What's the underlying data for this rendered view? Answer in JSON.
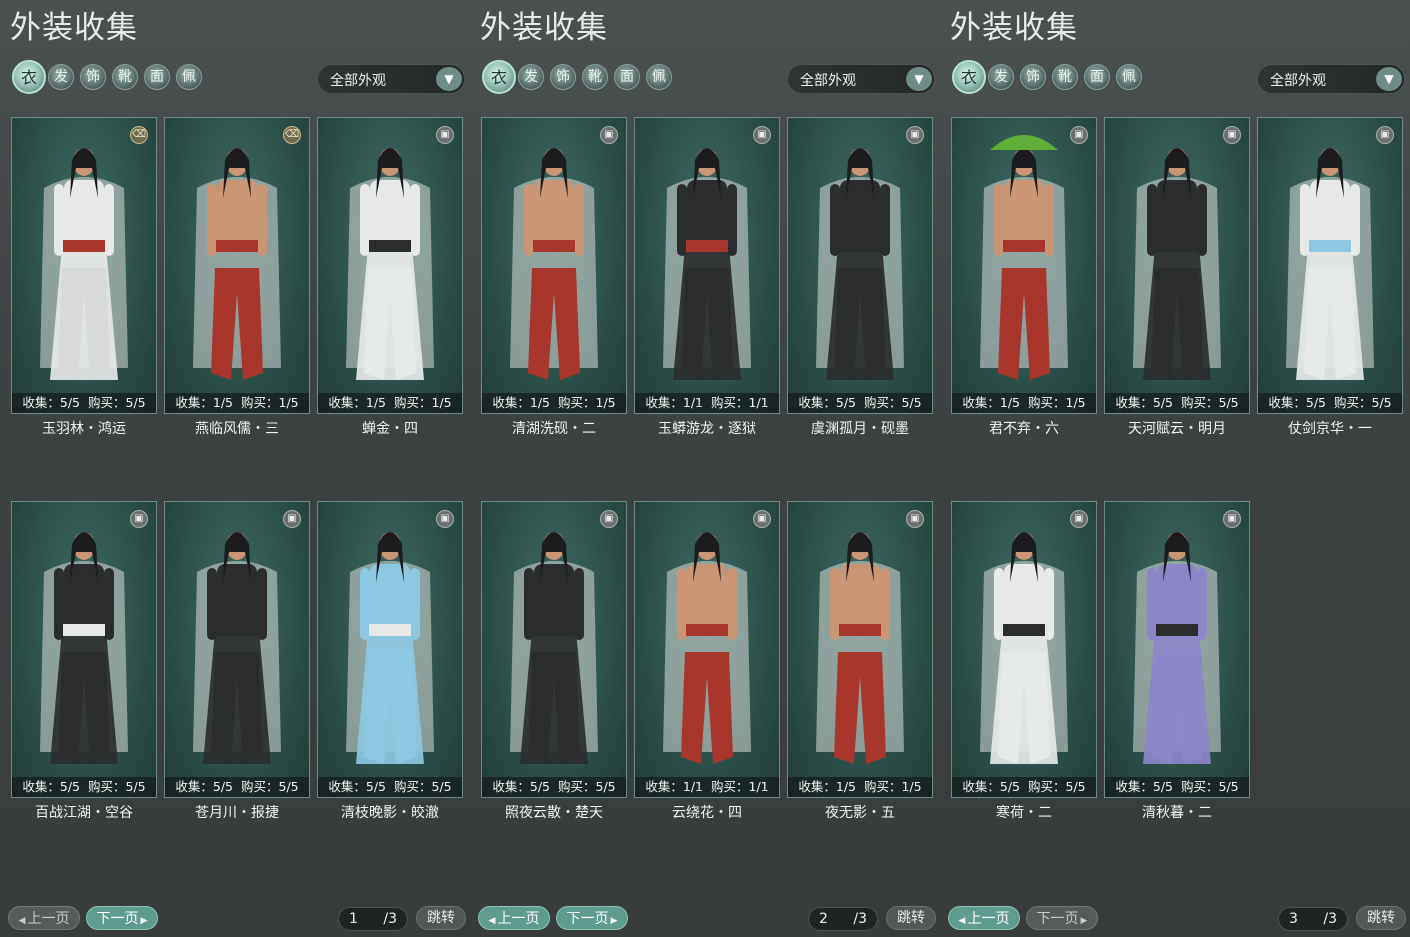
{
  "panels": [
    {
      "title": "外装收集",
      "filter_label": "全部外观",
      "pager": {
        "prev": "上一页",
        "next": "下一页",
        "current": "1",
        "total": "/3",
        "jump": "跳转"
      },
      "cards": [
        {
          "name": "玉羽林・鸿运",
          "collect": "收集：5/5",
          "buy": "购买：5/5",
          "icon": "trash-icon"
        },
        {
          "name": "燕临风儒・三",
          "collect": "收集：1/5",
          "buy": "购买：1/5",
          "icon": "trash-icon"
        },
        {
          "name": "蝉金・四",
          "collect": "收集：1/5",
          "buy": "购买：1/5",
          "icon": "wardrobe-icon"
        },
        {
          "name": "百战江湖・空谷",
          "collect": "收集：5/5",
          "buy": "购买：5/5",
          "icon": "wardrobe-icon"
        },
        {
          "name": "苍月川・报捷",
          "collect": "收集：5/5",
          "buy": "购买：5/5",
          "icon": "wardrobe-icon"
        },
        {
          "name": "清枝晚影・皎澈",
          "collect": "收集：5/5",
          "buy": "购买：5/5",
          "icon": "wardrobe-icon"
        }
      ]
    },
    {
      "title": "外装收集",
      "filter_label": "全部外观",
      "pager": {
        "prev": "上一页",
        "next": "下一页",
        "current": "2",
        "total": "/3",
        "jump": "跳转"
      },
      "cards": [
        {
          "name": "清湖洗砚・二",
          "collect": "收集：1/5",
          "buy": "购买：1/5",
          "icon": "wardrobe-icon"
        },
        {
          "name": "玉蟒游龙・逐狱",
          "collect": "收集：1/1",
          "buy": "购买：1/1",
          "icon": "wardrobe-icon"
        },
        {
          "name": "虞渊孤月・砚墨",
          "collect": "收集：5/5",
          "buy": "购买：5/5",
          "icon": "wardrobe-icon"
        },
        {
          "name": "照夜云散・楚天",
          "collect": "收集：5/5",
          "buy": "购买：5/5",
          "icon": "wardrobe-icon"
        },
        {
          "name": "云绕花・四",
          "collect": "收集：1/1",
          "buy": "购买：1/1",
          "icon": "wardrobe-icon"
        },
        {
          "name": "夜无影・五",
          "collect": "收集：1/5",
          "buy": "购买：1/5",
          "icon": "wardrobe-icon"
        }
      ]
    },
    {
      "title": "外装收集",
      "filter_label": "全部外观",
      "pager": {
        "prev": "上一页",
        "next": "下一页",
        "current": "3",
        "total": "/3",
        "jump": "跳转"
      },
      "cards": [
        {
          "name": "君不弃・六",
          "collect": "收集：1/5",
          "buy": "购买：1/5",
          "icon": "wardrobe-icon"
        },
        {
          "name": "天河赋云・明月",
          "collect": "收集：5/5",
          "buy": "购买：5/5",
          "icon": "wardrobe-icon"
        },
        {
          "name": "仗剑京华・一",
          "collect": "收集：5/5",
          "buy": "购买：5/5",
          "icon": "wardrobe-icon"
        },
        {
          "name": "寒荷・二",
          "collect": "收集：5/5",
          "buy": "购买：5/5",
          "icon": "wardrobe-icon"
        },
        {
          "name": "清秋暮・二",
          "collect": "收集：5/5",
          "buy": "购买：5/5",
          "icon": "wardrobe-icon"
        }
      ]
    }
  ],
  "category_icons": [
    "outfit-icon",
    "hair-icon",
    "top-icon",
    "shoes-icon",
    "mask-icon",
    "accessory-icon"
  ],
  "colors": {
    "background": "#3b403f",
    "card_bg": "#2d514b",
    "card_border": "#6e8b86",
    "accent": "#5f9b8f",
    "skin": "#c99575",
    "robe_white": "#e6e9e7",
    "robe_black": "#2a2c2e",
    "robe_red": "#a9362c",
    "robe_blue": "#8cc8e2",
    "robe_purple": "#8c86c8",
    "hat_green": "#5fae3a"
  },
  "outfits": [
    {
      "robe": "robe_white",
      "sash": "robe_red",
      "pants": "robe_black",
      "bare": false
    },
    {
      "robe": null,
      "sash": "robe_red",
      "pants": "robe_red",
      "bare": true
    },
    {
      "robe": "robe_white",
      "sash": "robe_black",
      "pants": "robe_white",
      "bare": false
    },
    {
      "robe": "robe_black",
      "sash": "robe_white",
      "pants": "robe_black",
      "bare": false
    },
    {
      "robe": "robe_black",
      "sash": "robe_black",
      "pants": "robe_black",
      "bare": false
    },
    {
      "robe": "robe_blue",
      "sash": "robe_white",
      "pants": "robe_blue",
      "bare": false
    },
    {
      "robe": null,
      "sash": "robe_red",
      "pants": "robe_red",
      "bare": true
    },
    {
      "robe": "robe_black",
      "sash": "robe_red",
      "pants": "robe_black",
      "bare": false
    },
    {
      "robe": "robe_black",
      "sash": "robe_black",
      "pants": "robe_black",
      "bare": false
    },
    {
      "robe": "robe_black",
      "sash": "robe_black",
      "pants": "robe_black",
      "bare": false
    },
    {
      "robe": null,
      "sash": "robe_red",
      "pants": "robe_red",
      "bare": true
    },
    {
      "robe": null,
      "sash": "robe_red",
      "pants": "robe_red",
      "bare": true
    },
    {
      "robe": null,
      "sash": "robe_red",
      "pants": "robe_red",
      "bare": true,
      "hat": "hat_green"
    },
    {
      "robe": "robe_black",
      "sash": "robe_black",
      "pants": "robe_black",
      "bare": false
    },
    {
      "robe": "robe_white",
      "sash": "robe_blue",
      "pants": "robe_white",
      "bare": false
    },
    {
      "robe": "robe_white",
      "sash": "robe_black",
      "pants": "robe_white",
      "bare": false
    },
    {
      "robe": "robe_purple",
      "sash": "robe_black",
      "pants": "robe_purple",
      "bare": false
    }
  ]
}
